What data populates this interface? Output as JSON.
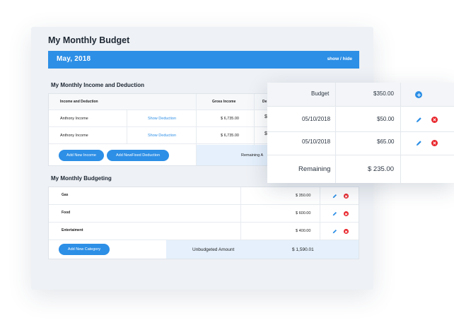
{
  "page": {
    "title": "My Monthly Budget"
  },
  "month_bar": {
    "label": "May, 2018",
    "show_label": "show",
    "separator": "/",
    "hide_label": "hide"
  },
  "income_section": {
    "title": "My Monthly Income and Deduction",
    "columns": [
      "Income and Deduction",
      "Gross Income",
      "De"
    ],
    "rows": [
      {
        "name": "Anthony Income",
        "action": "Show Deduction",
        "gross": "$ 6,735.00"
      },
      {
        "name": "Anthony Income",
        "action": "Show Deduction",
        "gross": "$ 6,735.00"
      }
    ],
    "add_income_label": "Add New Income",
    "add_fixed_deduction_label": "Add NewFixed Deduction",
    "remaining_label": "Remaining A"
  },
  "budgeting_section": {
    "title": "My Monthly Budgeting",
    "rows": [
      {
        "category": "Gas",
        "amount": "$ 350.00"
      },
      {
        "category": "Food",
        "amount": "$ 600.00"
      },
      {
        "category": "Entertaiment",
        "amount": "$ 400.00"
      }
    ],
    "add_category_label": "Add New Category",
    "unbudgeted_label": "Unbudgeted Amount",
    "unbudgeted_value": "$ 1,590.01"
  },
  "detail_card": {
    "budget_label": "Budget",
    "budget_value": "$350.00",
    "entries": [
      {
        "date": "05/10/2018",
        "amount": "$50.00"
      },
      {
        "date": "05/10/2018",
        "amount": "$65.00"
      }
    ],
    "remaining_label": "Remaining",
    "remaining_value": "$ 235.00"
  },
  "colors": {
    "accent": "#2d8fe6",
    "delete": "#e8252b",
    "shaded": "#e5f0fc",
    "background": "#eef1f5"
  },
  "icons": [
    "pencil-icon",
    "delete-icon",
    "add-circle-icon"
  ]
}
